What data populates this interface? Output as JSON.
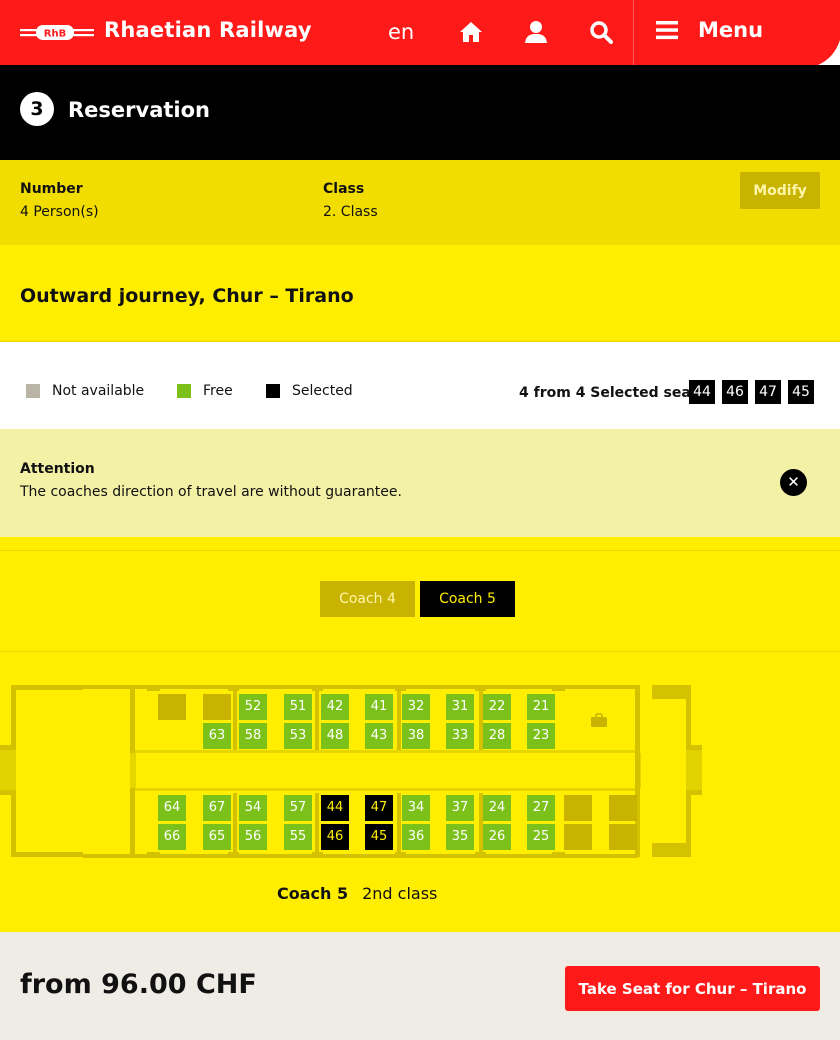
{
  "header": {
    "logo_text": "RhB",
    "brand": "Rhaetian Railway",
    "language": "en",
    "menu_label": "Menu"
  },
  "step": {
    "number": "3",
    "title": "Reservation"
  },
  "summary": {
    "number_label": "Number",
    "number_value": "4 Person(s)",
    "class_label": "Class",
    "class_value": "2. Class",
    "modify_label": "Modify"
  },
  "journey": {
    "title": "Outward journey, Chur – Tirano"
  },
  "legend": {
    "not_available": "Not available",
    "free": "Free",
    "selected": "Selected",
    "selected_summary": "4 from 4 Selected seats",
    "selected_seats": [
      "44",
      "46",
      "47",
      "45"
    ]
  },
  "attention": {
    "title": "Attention",
    "text": "The coaches direction of travel are without guarantee."
  },
  "coaches": {
    "tabs": [
      "Coach 4",
      "Coach 5"
    ],
    "active": "Coach 5"
  },
  "seatmap": {
    "seats": [
      {
        "num": "52",
        "state": "free"
      },
      {
        "num": "51",
        "state": "free"
      },
      {
        "num": "42",
        "state": "free"
      },
      {
        "num": "41",
        "state": "free"
      },
      {
        "num": "32",
        "state": "free"
      },
      {
        "num": "31",
        "state": "free"
      },
      {
        "num": "22",
        "state": "free"
      },
      {
        "num": "21",
        "state": "free"
      },
      {
        "num": "63",
        "state": "free"
      },
      {
        "num": "58",
        "state": "free"
      },
      {
        "num": "53",
        "state": "free"
      },
      {
        "num": "48",
        "state": "free"
      },
      {
        "num": "43",
        "state": "free"
      },
      {
        "num": "38",
        "state": "free"
      },
      {
        "num": "33",
        "state": "free"
      },
      {
        "num": "28",
        "state": "free"
      },
      {
        "num": "23",
        "state": "free"
      },
      {
        "num": "64",
        "state": "free"
      },
      {
        "num": "67",
        "state": "free"
      },
      {
        "num": "54",
        "state": "free"
      },
      {
        "num": "57",
        "state": "free"
      },
      {
        "num": "44",
        "state": "selected"
      },
      {
        "num": "47",
        "state": "selected"
      },
      {
        "num": "34",
        "state": "free"
      },
      {
        "num": "37",
        "state": "free"
      },
      {
        "num": "24",
        "state": "free"
      },
      {
        "num": "27",
        "state": "free"
      },
      {
        "num": "66",
        "state": "free"
      },
      {
        "num": "65",
        "state": "free"
      },
      {
        "num": "56",
        "state": "free"
      },
      {
        "num": "55",
        "state": "free"
      },
      {
        "num": "46",
        "state": "selected"
      },
      {
        "num": "45",
        "state": "selected"
      },
      {
        "num": "36",
        "state": "free"
      },
      {
        "num": "35",
        "state": "free"
      },
      {
        "num": "26",
        "state": "free"
      },
      {
        "num": "25",
        "state": "free"
      }
    ],
    "coach_name": "Coach 5",
    "coach_class": "2nd class"
  },
  "footer": {
    "price": "from 96.00 CHF",
    "cta": "Take Seat for Chur – Tirano"
  },
  "colors": {
    "brand_red": "#ff1a1a",
    "yellow": "#ffee00",
    "free_green": "#7cc11a",
    "not_available": "#c8b400",
    "selected_black": "#000000"
  }
}
